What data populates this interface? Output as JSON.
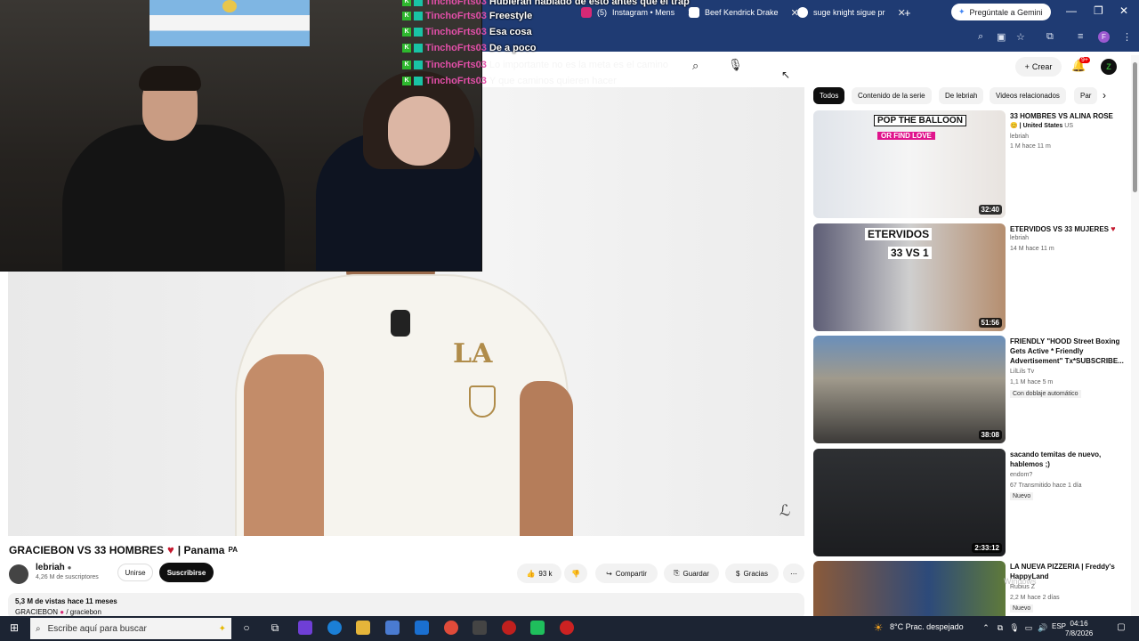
{
  "browser": {
    "tabs": [
      {
        "label": "Instagram • Mens",
        "prefix": "(5)",
        "icon": "instagram-icon",
        "color": "#d62976"
      },
      {
        "label": "Beef Kendrick Drake",
        "icon": "globe-icon",
        "color": "#ffffff"
      },
      {
        "label": "suge knight sigue pr",
        "icon": "google-icon",
        "color": "#ffffff"
      }
    ],
    "new_tab": "+",
    "gemini": "Pregúntale a Gemini",
    "profile_letter": "F"
  },
  "chat": [
    {
      "user": "TinchoFrts03",
      "text": "Hubieran hablado de esto antes que el trap"
    },
    {
      "user": "TinchoFrts03",
      "text": "Freestyle"
    },
    {
      "user": "TinchoFrts03",
      "text": "Esa cosa"
    },
    {
      "user": "TinchoFrts03",
      "text": "De a poco"
    },
    {
      "user": "TinchoFrts03",
      "text": "Lo importante no es la meta es el camino"
    },
    {
      "user": "TinchoFrts03",
      "text": "Y que caminos quieren hacer"
    }
  ],
  "header": {
    "create": "Crear",
    "notifications": "9+"
  },
  "video": {
    "title": "GRACIEBON VS 33 HOMBRES",
    "title_suffix": "| Panama",
    "country": "PA",
    "channel": "lebriah",
    "subscribers": "4,26 M de suscriptores",
    "join": "Unirse",
    "subscribe": "Suscribirse",
    "likes": "93 k",
    "share": "Compartir",
    "save": "Guardar",
    "thanks": "Gracias",
    "views": "5,3 M de vistas  hace 11 meses",
    "tag": "GRACIEBON",
    "tag_handle": "/ graciebon"
  },
  "chips": [
    "Todos",
    "Contenido de la serie",
    "De lebriah",
    "Videos relacionados",
    "Par"
  ],
  "recommendations": [
    {
      "title": "33 HOMBRES VS ALINA ROSE",
      "title2": "| United States",
      "country": "US",
      "channel": "lebriah",
      "meta": "1 M  hace 11 m",
      "duration": "32:40",
      "thumb_text": "POP THE BALLOON",
      "thumb_sub": "OR FIND LOVE"
    },
    {
      "title": "ETERVIDOS VS 33 MUJERES",
      "channel": "lebriah",
      "meta": "14 M  hace 11 m",
      "duration": "51:56",
      "thumb_text": "ETERVIDOS",
      "thumb_sub": "33 VS 1"
    },
    {
      "title": "FRIENDLY \"HOOD Street Boxing Gets Active * Friendly Advertisement\" Tx*SUBSCRIBE...",
      "channel": "LilLils Tv",
      "meta": "1,1 M  hace 5 m",
      "tag": "Con doblaje automático",
      "duration": "38:08"
    },
    {
      "title": "sacando temitas de nuevo, hablemos ;)",
      "channel": "endom?",
      "meta": "67  Transmitido hace 1 día",
      "tag": "Nuevo",
      "duration": "2:33:12"
    },
    {
      "title": "LA NUEVA PIZZERIA | Freddy's HappyLand",
      "channel": "Rubius Z",
      "meta": "2,2 M  hace 2 días",
      "tag": "Nuevo"
    }
  ],
  "windows_watermark": "Windows",
  "taskbar": {
    "search_placeholder": "Escribe aquí para buscar",
    "weather": "8°C  Prac. despejado",
    "lang": "ESP",
    "time": "04:16",
    "date": "7/8/2026"
  }
}
